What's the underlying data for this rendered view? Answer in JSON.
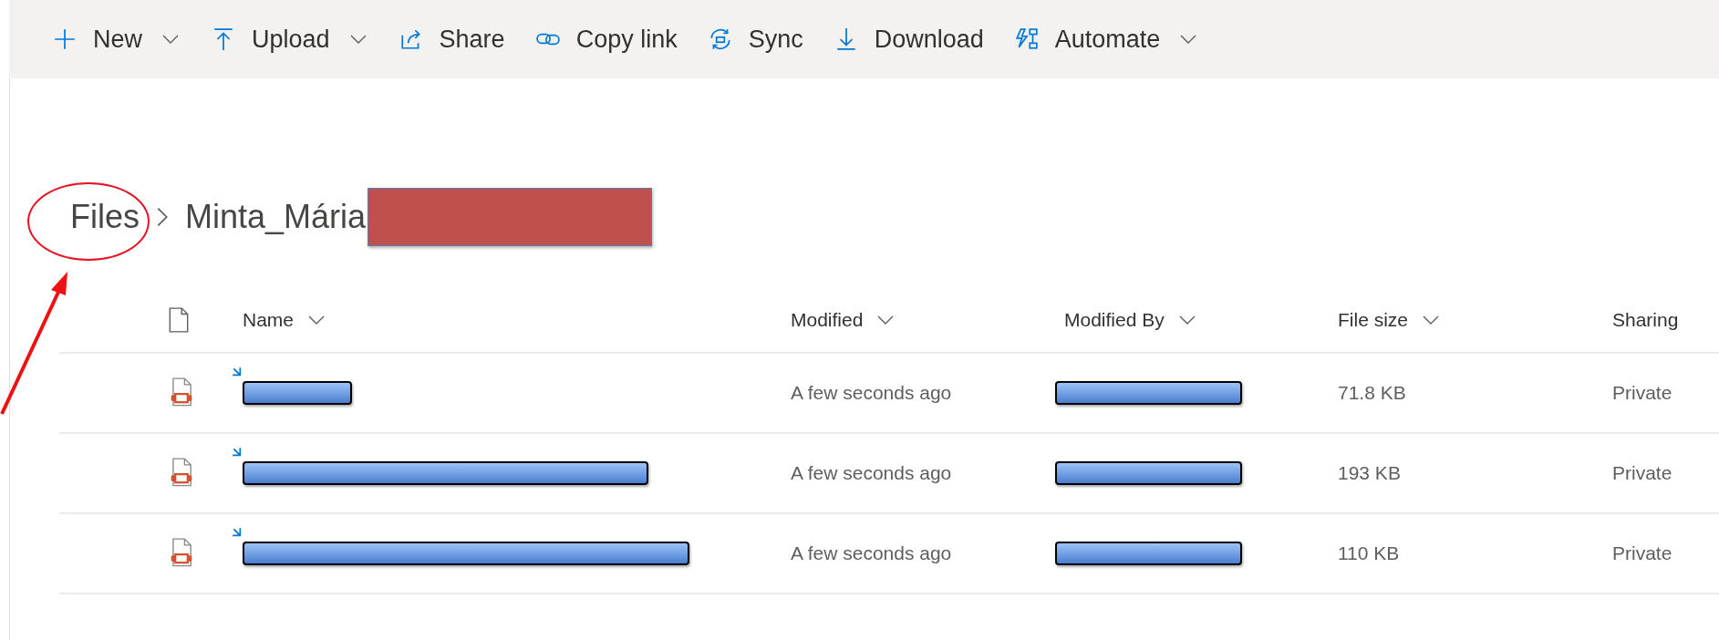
{
  "toolbar": [
    {
      "kind": "new",
      "label": "New",
      "dropdown": true
    },
    {
      "kind": "upload",
      "label": "Upload",
      "dropdown": true
    },
    {
      "kind": "share",
      "label": "Share",
      "dropdown": false
    },
    {
      "kind": "link",
      "label": "Copy link",
      "dropdown": false
    },
    {
      "kind": "sync",
      "label": "Sync",
      "dropdown": false
    },
    {
      "kind": "download",
      "label": "Download",
      "dropdown": false
    },
    {
      "kind": "automate",
      "label": "Automate",
      "dropdown": true
    }
  ],
  "breadcrumb": [
    {
      "label": "Files",
      "annotated": true
    },
    {
      "label": "Minta_Mária",
      "redacted": true
    }
  ],
  "table": {
    "columns": [
      {
        "label": "Name",
        "sortable": true
      },
      {
        "label": "Modified",
        "sortable": true
      },
      {
        "label": "Modified By",
        "sortable": true
      },
      {
        "label": "File size",
        "sortable": true
      },
      {
        "label": "Sharing",
        "sortable": false
      }
    ],
    "rows": [
      {
        "new": true,
        "modified": "A few seconds ago",
        "file_size": "71.8 KB",
        "sharing": "Private"
      },
      {
        "new": true,
        "modified": "A few seconds ago",
        "file_size": "193 KB",
        "sharing": "Private"
      },
      {
        "new": true,
        "modified": "A few seconds ago",
        "file_size": "110 KB",
        "sharing": "Private"
      }
    ]
  }
}
